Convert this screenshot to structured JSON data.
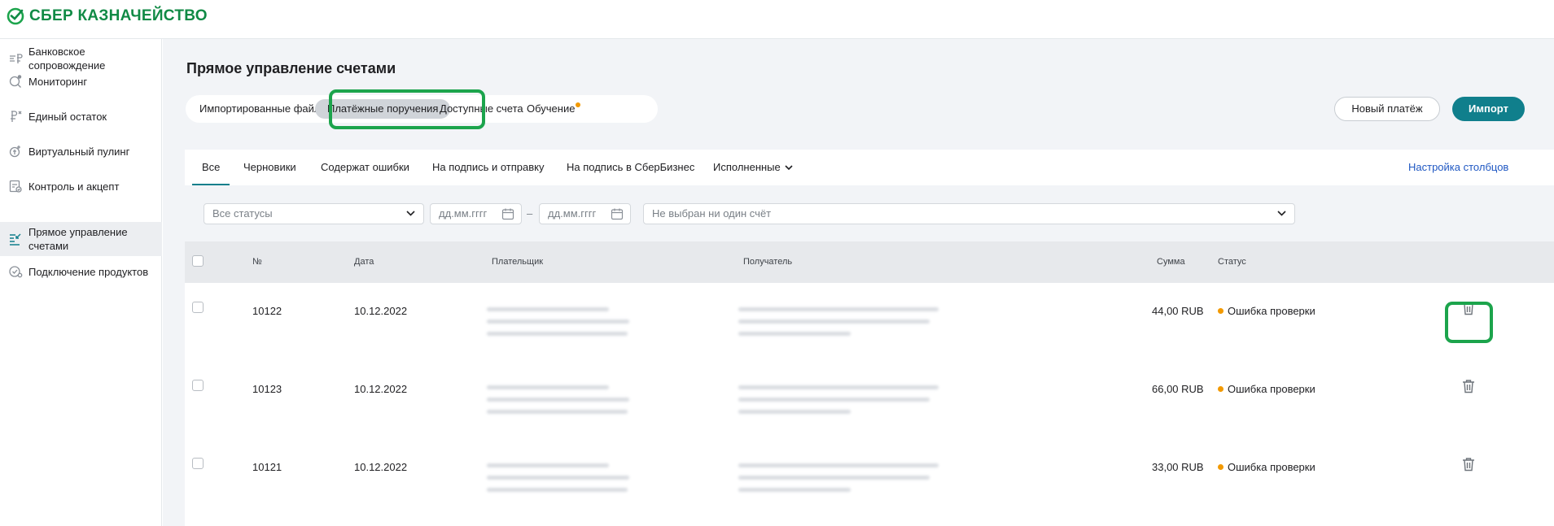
{
  "brand": {
    "name": "СБЕР КАЗНАЧЕЙСТВО",
    "color": "#108a45"
  },
  "sidebar": {
    "items": [
      {
        "label": "Банковское сопровождение",
        "icon": "bank-support-icon"
      },
      {
        "label": "Мониторинг",
        "icon": "monitoring-icon"
      },
      {
        "label": "Единый остаток",
        "icon": "single-balance-icon"
      },
      {
        "label": "Виртуальный пулинг",
        "icon": "virtual-pooling-icon"
      },
      {
        "label": "Контроль и акцепт",
        "icon": "control-accept-icon"
      },
      {
        "label": "Прямое управление счетами",
        "icon": "direct-accounts-icon",
        "active": true
      },
      {
        "label": "Подключение продуктов",
        "icon": "connect-products-icon"
      }
    ]
  },
  "page": {
    "title": "Прямое управление счетами",
    "segments": [
      {
        "label": "Импортированные файлы"
      },
      {
        "label": "Платёжные поручения",
        "active": true
      },
      {
        "label": "Доступные счета"
      },
      {
        "label": "Обучение",
        "badge": true
      }
    ],
    "new_payment_label": "Новый платёж",
    "import_label": "Импорт",
    "accent_color": "#107f8c"
  },
  "tabs": {
    "items": [
      {
        "label": "Все",
        "active": true
      },
      {
        "label": "Черновики"
      },
      {
        "label": "Содержат ошибки"
      },
      {
        "label": "На подпись и отправку"
      },
      {
        "label": "На подпись в СберБизнес"
      },
      {
        "label": "Исполненные"
      }
    ],
    "configure_columns_label": "Настройка столбцов"
  },
  "filters": {
    "status_placeholder": "Все статусы",
    "date_from_placeholder": "дд.мм.гггг",
    "date_separator": "–",
    "date_to_placeholder": "дд.мм.гггг",
    "account_placeholder": "Не выбран ни один счёт"
  },
  "table": {
    "columns": {
      "number": "№",
      "date": "Дата",
      "payer": "Плательщик",
      "recipient": "Получатель",
      "amount": "Сумма",
      "status": "Статус"
    },
    "rows": [
      {
        "number": "10122",
        "date": "10.12.2022",
        "amount": "44,00 RUB",
        "status": "Ошибка проверки"
      },
      {
        "number": "10123",
        "date": "10.12.2022",
        "amount": "66,00 RUB",
        "status": "Ошибка проверки"
      },
      {
        "number": "10121",
        "date": "10.12.2022",
        "amount": "33,00 RUB",
        "status": "Ошибка проверки"
      }
    ],
    "status_color": "#f29900"
  }
}
